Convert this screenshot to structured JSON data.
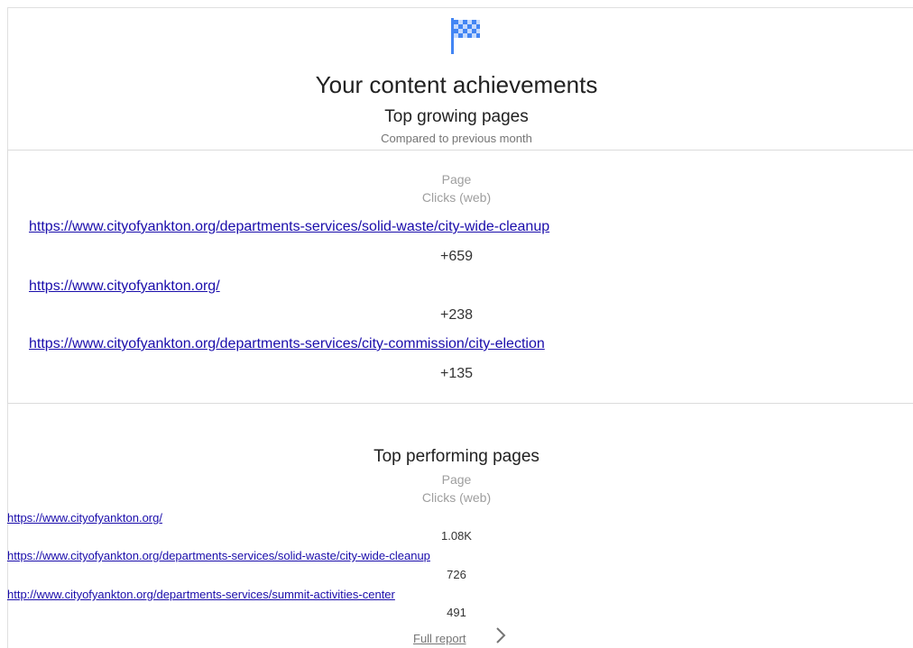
{
  "header": {
    "icon": "checkered-flag-icon",
    "title": "Your content achievements"
  },
  "top_growing": {
    "title": "Top growing pages",
    "caption": "Compared to previous month",
    "column_page": "Page",
    "column_clicks": "Clicks (web)",
    "rows": [
      {
        "url": "https://www.cityofyankton.org/departments-services/solid-waste/city-wide-cleanup",
        "clicks": "+659"
      },
      {
        "url": "https://www.cityofyankton.org/",
        "clicks": "+238"
      },
      {
        "url": "https://www.cityofyankton.org/departments-services/city-commission/city-election",
        "clicks": "+135"
      }
    ]
  },
  "top_performing": {
    "title": "Top performing pages",
    "column_page": "Page",
    "column_clicks": "Clicks (web)",
    "rows": [
      {
        "url": "https://www.cityofyankton.org/",
        "clicks": "1.08K"
      },
      {
        "url": "https://www.cityofyankton.org/departments-services/solid-waste/city-wide-cleanup",
        "clicks": "726"
      },
      {
        "url": "http://www.cityofyankton.org/departments-services/summit-activities-center",
        "clicks": "491"
      }
    ],
    "full_report_label": "Full report",
    "full_report_icon": "chevron-right-icon"
  },
  "colors": {
    "link": "#1a0dab",
    "flag": "#4285f4"
  }
}
